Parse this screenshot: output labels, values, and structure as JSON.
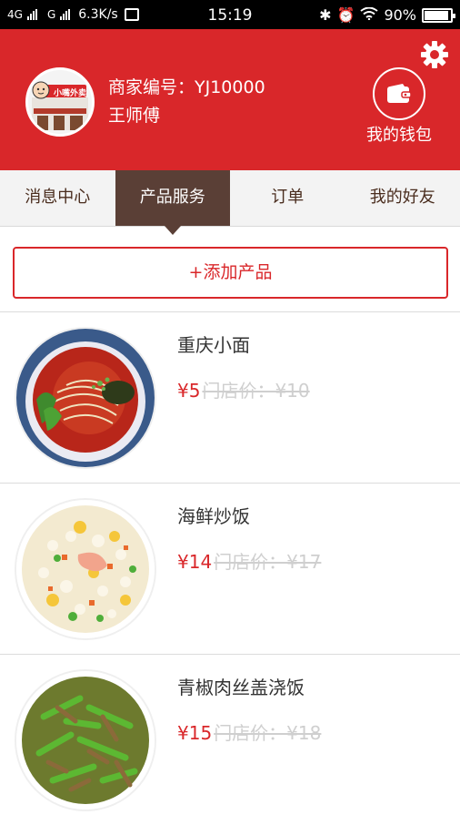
{
  "status_bar": {
    "network1": "4G",
    "network2": "G",
    "speed": "6.3K/s",
    "time": "15:19",
    "battery": "90%"
  },
  "header": {
    "logo_text": "小嘴外卖",
    "merchant_id": "商家编号：YJ10000",
    "merchant_name": "王师傅",
    "wallet_label": "我的钱包"
  },
  "tabs": [
    {
      "label": "消息中心",
      "active": false
    },
    {
      "label": "产品服务",
      "active": true
    },
    {
      "label": "订单",
      "active": false
    },
    {
      "label": "我的好友",
      "active": false
    }
  ],
  "add_button": "+添加产品",
  "products": [
    {
      "name": "重庆小面",
      "price": "¥5",
      "store_price": "门店价：¥10",
      "image": "noodle-bowl"
    },
    {
      "name": "海鲜炒饭",
      "price": "¥14",
      "store_price": "门店价：¥17",
      "image": "fried-rice"
    },
    {
      "name": "青椒肉丝盖浇饭",
      "price": "¥15",
      "store_price": "门店价：¥18",
      "image": "pepper-pork"
    }
  ],
  "colors": {
    "brand_red": "#d9272a",
    "tab_active": "#5a3f36",
    "tab_text": "#4a2d1e"
  }
}
